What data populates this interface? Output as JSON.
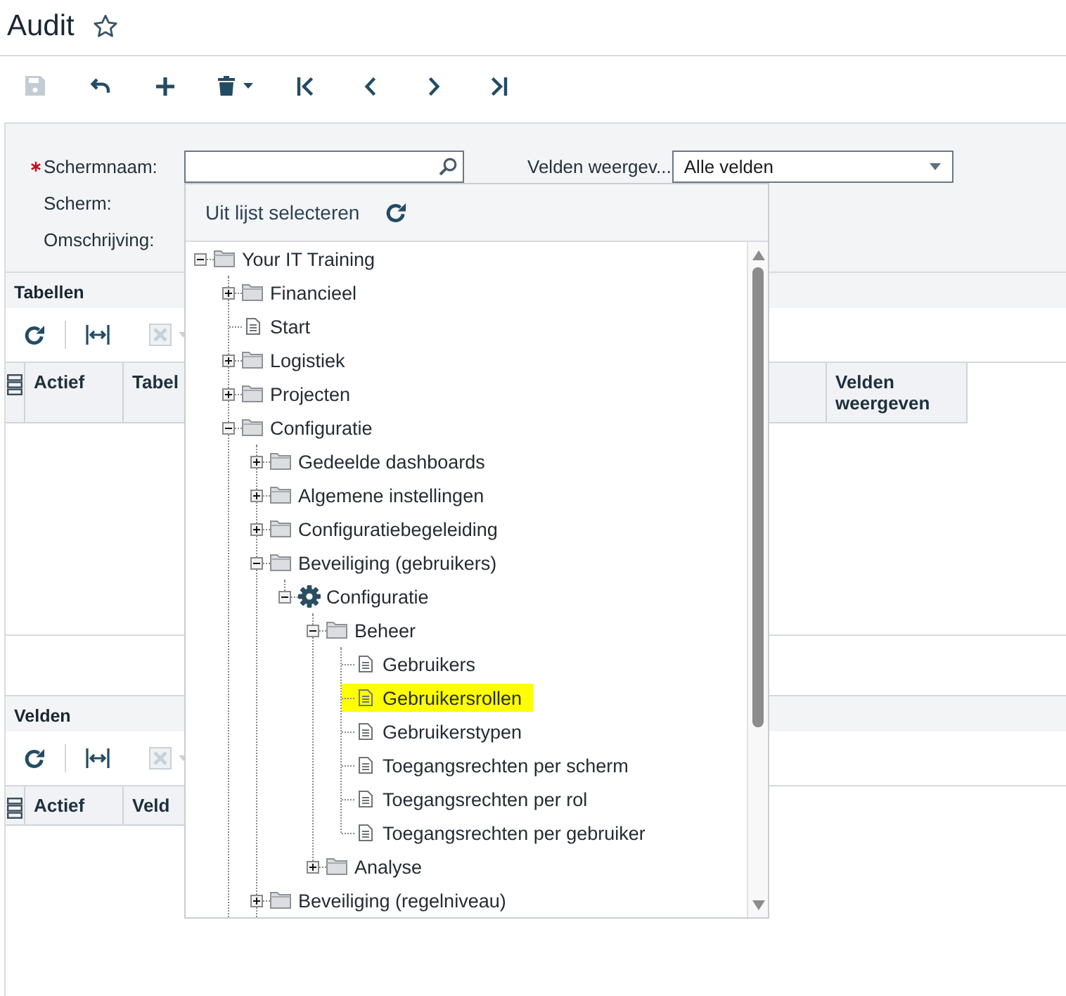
{
  "page": {
    "title": "Audit",
    "favorite": false
  },
  "toolbar": [
    {
      "kind": "save",
      "disabled": true
    },
    {
      "kind": "undo",
      "disabled": false
    },
    {
      "kind": "add",
      "disabled": false
    },
    {
      "kind": "delete",
      "disabled": false
    },
    {
      "kind": "first",
      "disabled": false
    },
    {
      "kind": "previous",
      "disabled": false
    },
    {
      "kind": "next",
      "disabled": false
    },
    {
      "kind": "last",
      "disabled": false
    }
  ],
  "form": {
    "fields": [
      {
        "label": "Schermnaam:",
        "required": true,
        "kind": "search"
      },
      {
        "label": "Scherm:",
        "required": false
      },
      {
        "label": "Omschrijving:",
        "required": false
      }
    ],
    "display": {
      "label": "Velden weergev...",
      "value": "Alle velden"
    }
  },
  "lookup": {
    "tab": "Uit lijst selecteren",
    "tree": [
      {
        "label": "Your IT Training",
        "kind": "folder",
        "expanded": true,
        "selected": false,
        "more_children_below": true,
        "children": [
          {
            "label": "Financieel",
            "kind": "folder",
            "expanded": false,
            "selected": false
          },
          {
            "label": "Start",
            "kind": "page",
            "selected": false
          },
          {
            "label": "Logistiek",
            "kind": "folder",
            "expanded": false,
            "selected": false
          },
          {
            "label": "Projecten",
            "kind": "folder",
            "expanded": false,
            "selected": false
          },
          {
            "label": "Configuratie",
            "kind": "folder",
            "expanded": true,
            "selected": false,
            "more_children_below": true,
            "children": [
              {
                "label": "Gedeelde dashboards",
                "kind": "folder",
                "expanded": false,
                "selected": false
              },
              {
                "label": "Algemene instellingen",
                "kind": "folder",
                "expanded": false,
                "selected": false
              },
              {
                "label": "Configuratiebegeleiding",
                "kind": "folder",
                "expanded": false,
                "selected": false
              },
              {
                "label": "Beveiliging (gebruikers)",
                "kind": "folder",
                "expanded": true,
                "selected": false,
                "children": [
                  {
                    "label": "Configuratie",
                    "kind": "module",
                    "expanded": true,
                    "selected": false,
                    "children": [
                      {
                        "label": "Beheer",
                        "kind": "folder",
                        "expanded": true,
                        "selected": false,
                        "children": [
                          {
                            "label": "Gebruikers",
                            "kind": "page",
                            "selected": false
                          },
                          {
                            "label": "Gebruikersrollen",
                            "kind": "page",
                            "selected": true
                          },
                          {
                            "label": "Gebruikerstypen",
                            "kind": "page",
                            "selected": false
                          },
                          {
                            "label": "Toegangsrechten per scherm",
                            "kind": "page",
                            "selected": false
                          },
                          {
                            "label": "Toegangsrechten per rol",
                            "kind": "page",
                            "selected": false
                          },
                          {
                            "label": "Toegangsrechten per gebruiker",
                            "kind": "page",
                            "selected": false
                          }
                        ]
                      },
                      {
                        "label": "Analyse",
                        "kind": "folder",
                        "expanded": false,
                        "selected": false
                      }
                    ]
                  }
                ]
              },
              {
                "label": "Beveiliging (regelniveau)",
                "kind": "folder",
                "expanded": false,
                "selected": false
              }
            ]
          }
        ]
      }
    ]
  },
  "sections": [
    {
      "title": "Tabellen",
      "tools": [
        {
          "kind": "refresh",
          "disabled": false
        },
        {
          "kind": "fit_columns",
          "disabled": false
        },
        {
          "kind": "export",
          "disabled": true
        }
      ],
      "columns": [
        {
          "label": "Actief"
        },
        {
          "label": "Tabel"
        },
        {
          "label": "Velden weergeven"
        }
      ]
    },
    {
      "title": "Velden",
      "tools": [
        {
          "kind": "refresh",
          "disabled": false
        },
        {
          "kind": "fit_columns",
          "disabled": false
        },
        {
          "kind": "export",
          "disabled": true
        }
      ],
      "columns": [
        {
          "label": "Actief"
        },
        {
          "label": "Veld"
        }
      ]
    }
  ]
}
